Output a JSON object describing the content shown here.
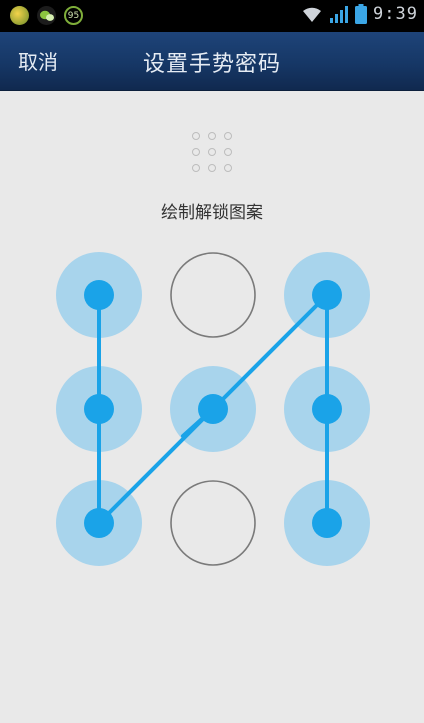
{
  "status_bar": {
    "time": "9:39",
    "badge_number": "95",
    "icons": [
      "app-icon",
      "wechat-icon",
      "notification-badge-icon",
      "wifi-icon",
      "signal-icon",
      "battery-icon"
    ]
  },
  "header": {
    "cancel_label": "取消",
    "title": "设置手势密码"
  },
  "hint_text": "绘制解锁图案",
  "pattern": {
    "selected_nodes": [
      1,
      4,
      7,
      5,
      3,
      6,
      9
    ],
    "accent_color": "#1aa3e8",
    "highlight_color": "#a8d4ec"
  }
}
